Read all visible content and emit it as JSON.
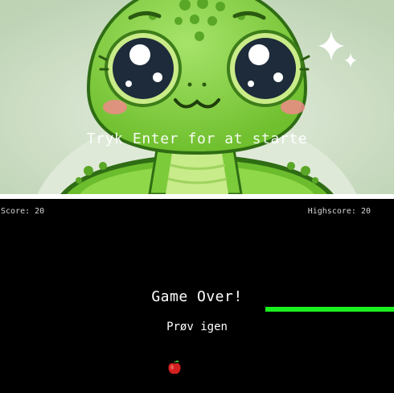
{
  "splash": {
    "start_prompt": "Tryk Enter for at starte",
    "mascot_icon": "turtle-mascot-icon",
    "sparkle_icon": "sparkle-icon"
  },
  "hud": {
    "score_label": "Score: 20",
    "highscore_label": "Highscore: 20"
  },
  "game": {
    "game_over_text": "Game Over!",
    "retry_label": "Prøv igen",
    "snake_color": "#19f01e",
    "board_color": "#000000",
    "food_icon": "apple-icon"
  }
}
